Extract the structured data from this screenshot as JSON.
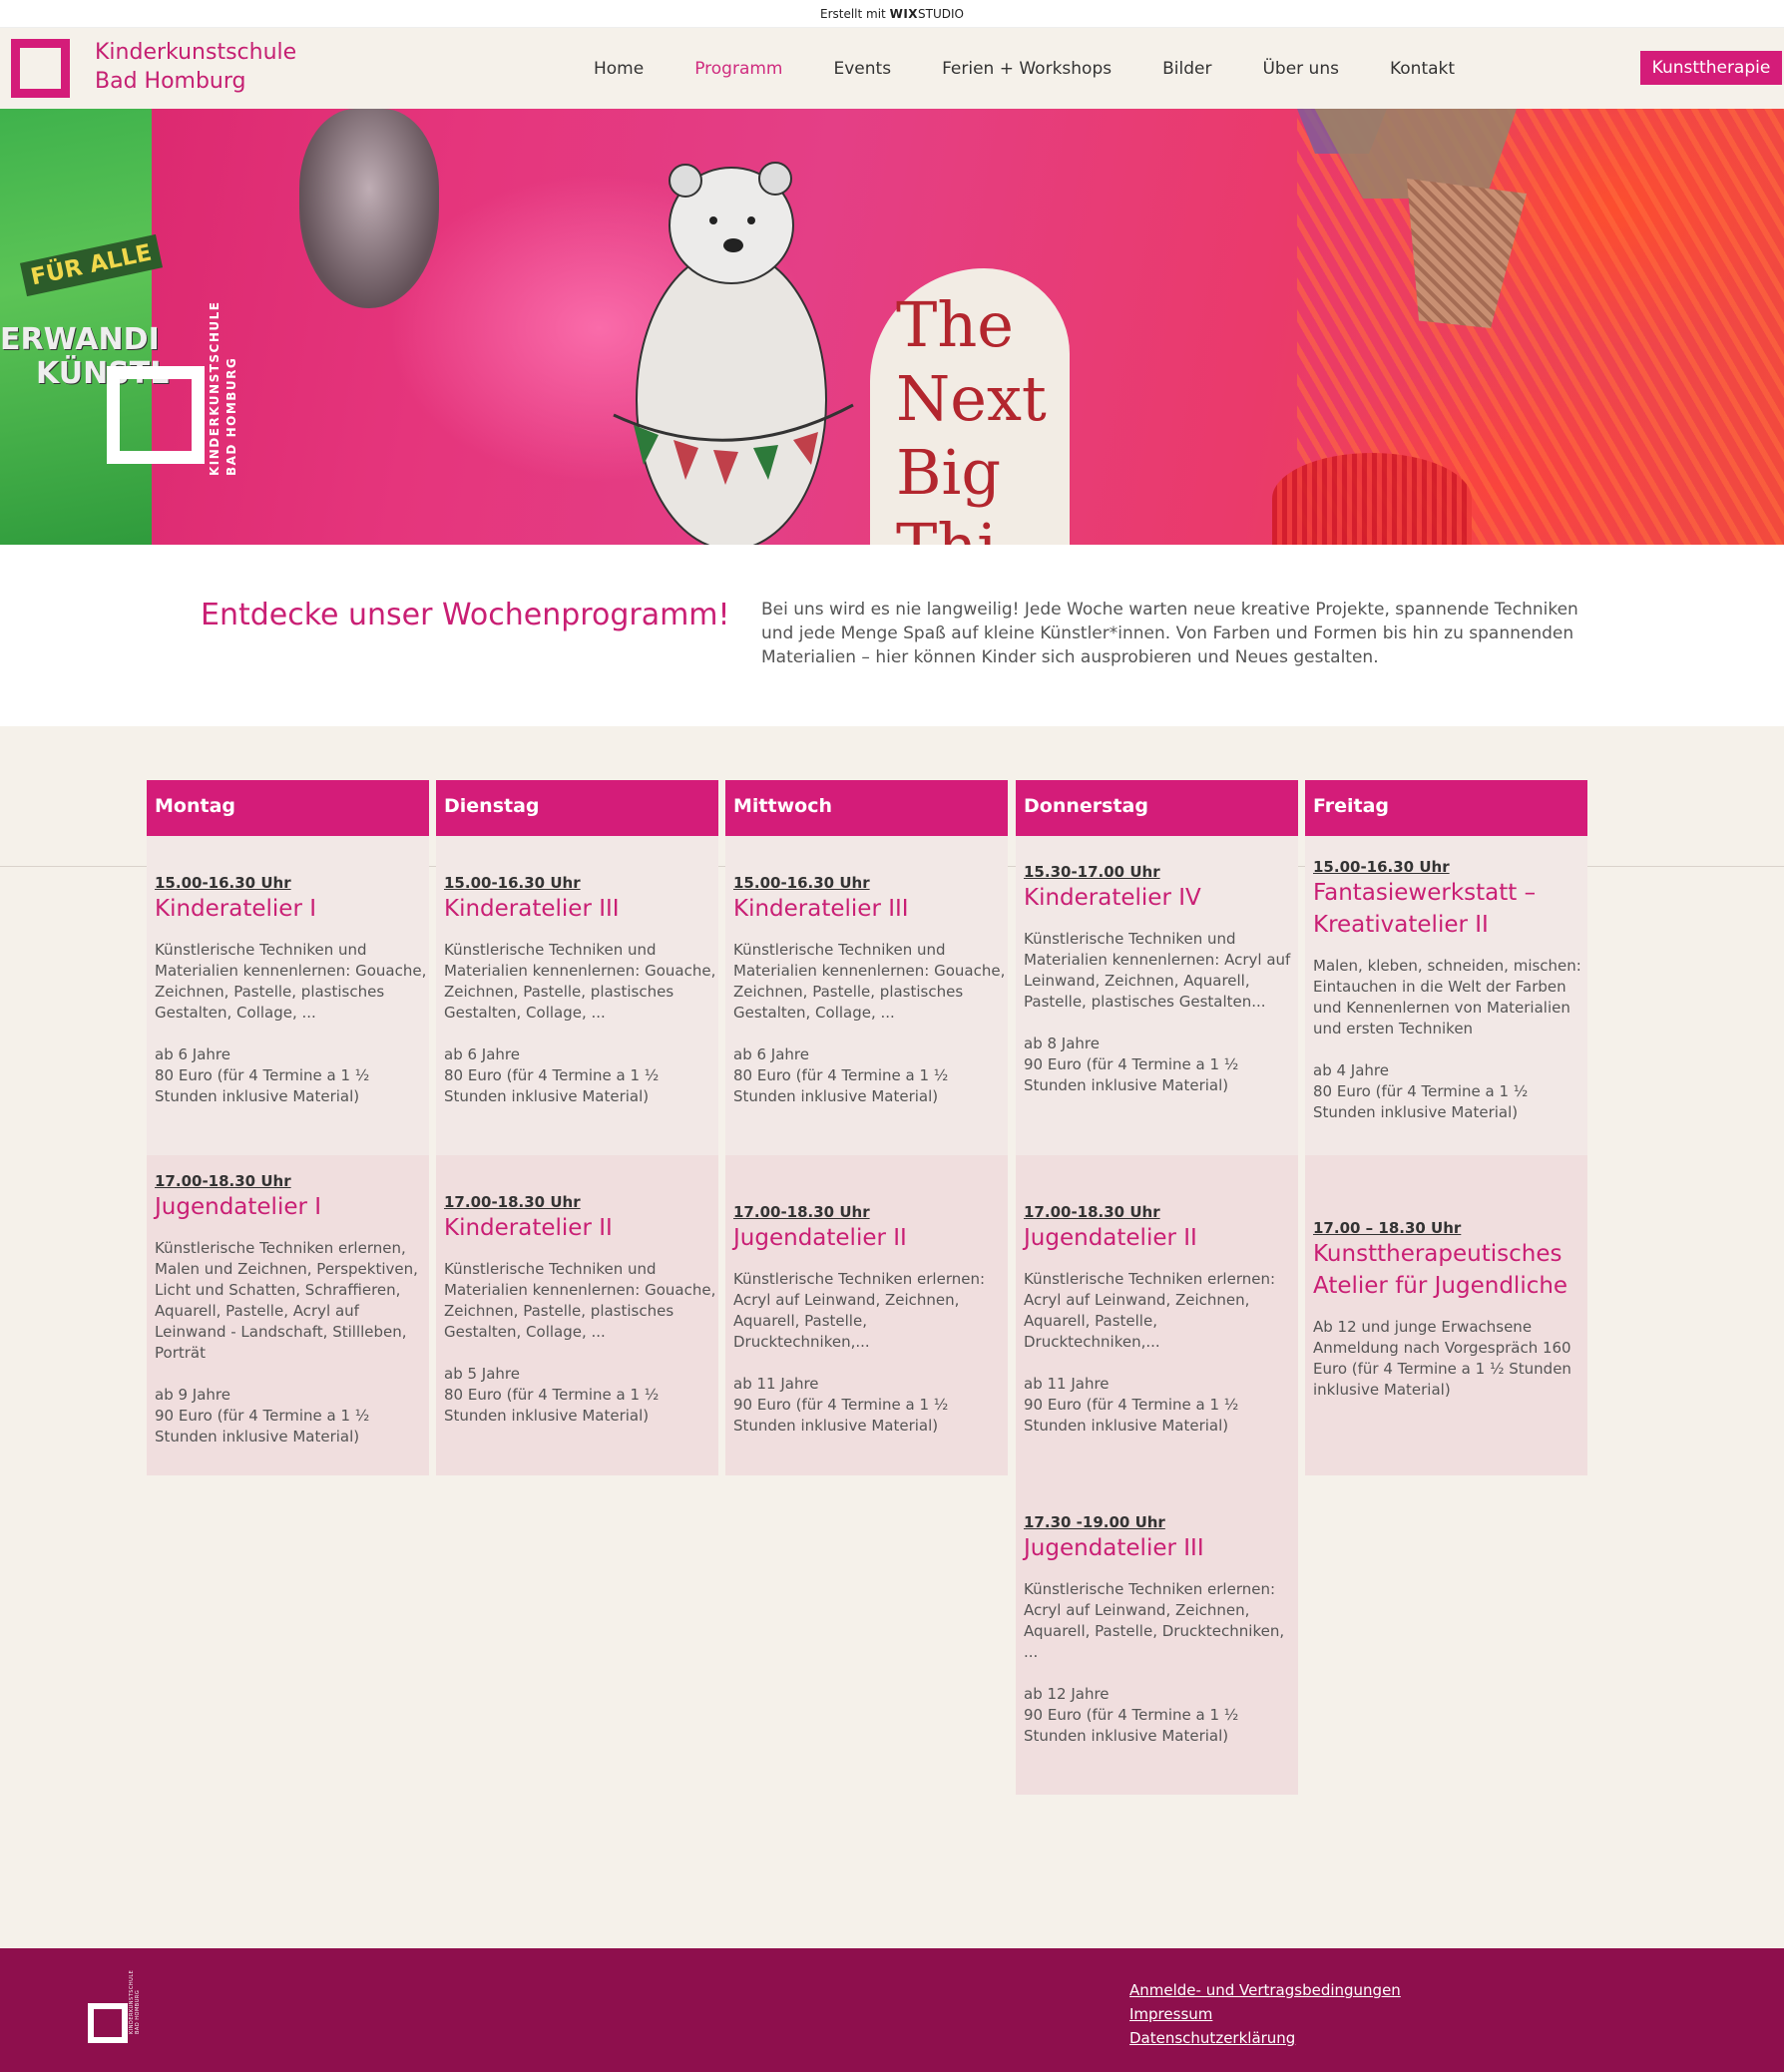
{
  "wix_banner": {
    "prefix": "Erstellt mit",
    "brand": "WIX",
    "suffix": "STUDIO"
  },
  "header": {
    "brand_line1": "Kinderkunstschule",
    "brand_line2": "Bad Homburg",
    "nav": [
      "Home",
      "Programm",
      "Events",
      "Ferien + Workshops",
      "Bilder",
      "Über uns",
      "Kontakt"
    ],
    "active_nav": "Programm",
    "cta": "Kunsttherapie",
    "accent_color": "#d41c79"
  },
  "hero": {
    "sticker": "FÜR ALLE",
    "background_word1": "ERWANDI",
    "background_word2": "KÜNSTL",
    "logo_text_line1": "KINDERKUNSTSCHULE",
    "logo_text_line2": "BAD HOMBURG",
    "headline": [
      "The",
      "Next",
      "Big",
      "Thi"
    ]
  },
  "intro": {
    "title": "Entdecke unser Wochenprogramm!",
    "text": "Bei uns wird es nie langweilig! Jede Woche warten neue kreative Projekte, spannende Techniken und jede Menge Spaß auf kleine Künstler*innen. Von Farben und Formen bis hin zu spannenden Materialien – hier können Kinder sich ausprobieren und Neues gestalten."
  },
  "schedule": [
    {
      "day": "Montag",
      "slots": [
        {
          "time": "15.00-16.30 Uhr",
          "title": "Kinderatelier I",
          "desc": "Künstlerische Techniken und Materialien kennenlernen: Gouache, Zeichnen, Pastelle, plastisches Gestalten, Collage, ...",
          "age": "ab 6 Jahre",
          "price": "80 Euro (für 4 Termine a 1 ½ Stunden inklusive Material)"
        },
        {
          "time": "17.00-18.30 Uhr",
          "title": "Jugendatelier I",
          "desc": "Künstlerische Techniken erlernen, Malen und Zeichnen, Perspektiven, Licht und Schatten, Schraffieren, Aquarell, Pastelle, Acryl auf Leinwand - Landschaft, Stillleben, Porträt",
          "age": "ab 9 Jahre",
          "price": "90 Euro (für 4 Termine a 1 ½ Stunden inklusive Material)"
        }
      ]
    },
    {
      "day": "Dienstag",
      "slots": [
        {
          "time": "15.00-16.30 Uhr",
          "title": "Kinderatelier III",
          "desc": "Künstlerische Techniken und Materialien kennenlernen: Gouache, Zeichnen, Pastelle, plastisches Gestalten, Collage, ...",
          "age": "ab 6 Jahre",
          "price": "80 Euro (für 4 Termine a  1 ½ Stunden inklusive Material)"
        },
        {
          "time": "17.00-18.30 Uhr",
          "title": "Kinderatelier II",
          "desc": "Künstlerische Techniken und Materialien kennenlernen: Gouache, Zeichnen, Pastelle, plastisches Gestalten, Collage, ...",
          "age": "ab 5 Jahre",
          "price": "80 Euro (für 4 Termine a 1 ½ Stunden inklusive Material)"
        }
      ]
    },
    {
      "day": "Mittwoch",
      "slots": [
        {
          "time": "15.00-16.30 Uhr",
          "title": "Kinderatelier III",
          "desc": "Künstlerische Techniken und Materialien kennenlernen: Gouache, Zeichnen, Pastelle, plastisches Gestalten, Collage, ...",
          "age": "ab 6 Jahre",
          "price": "80 Euro (für 4 Termine a  1 ½ Stunden inklusive Material)"
        },
        {
          "time": "17.00-18.30 Uhr",
          "title": "Jugendatelier II",
          "desc": "Künstlerische Techniken erlernen: Acryl auf Leinwand, Zeichnen, Aquarell, Pastelle, Drucktechniken,...",
          "age": "ab 11 Jahre",
          "price": "90 Euro (für 4 Termine a 1 ½ Stunden inklusive Material)"
        }
      ]
    },
    {
      "day": "Donnerstag",
      "slots": [
        {
          "time": "15.30-17.00 Uhr",
          "title": "Kinderatelier IV",
          "desc": "Künstlerische Techniken und Materialien kennenlernen: Acryl auf Leinwand, Zeichnen, Aquarell, Pastelle, plastisches Gestalten...",
          "age": "ab 8 Jahre",
          "price": "90 Euro (für 4 Termine a 1 ½ Stunden inklusive Material)"
        },
        {
          "time": "17.00-18.30 Uhr",
          "title": "Jugendatelier II",
          "desc": "Künstlerische Techniken erlernen: Acryl auf Leinwand, Zeichnen, Aquarell, Pastelle, Drucktechniken,...",
          "age": "ab 11 Jahre",
          "price": "90 Euro (für 4 Termine a 1 ½ Stunden inklusive Material)"
        },
        {
          "time": "17.30 -19.00 Uhr",
          "title": "Jugendatelier III",
          "desc": "Künstlerische Techniken erlernen: Acryl auf Leinwand, Zeichnen, Aquarell, Pastelle, Drucktechniken, ...",
          "age": "ab 12 Jahre",
          "price": "90 Euro (für 4 Termine a 1 ½ Stunden inklusive Material)"
        }
      ]
    },
    {
      "day": "Freitag",
      "slots": [
        {
          "time": "15.00-16.30 Uhr",
          "title": "Fantasiewerkstatt – Kreativatelier II",
          "desc": "Malen, kleben, schneiden, mischen: Eintauchen in die Welt der Farben und Kennenlernen von  Materialien und ersten Techniken",
          "age": "ab 4 Jahre",
          "price": "80 Euro (für 4 Termine a 1 ½ Stunden inklusive Material)"
        },
        {
          "time": "17.00 – 18.30 Uhr",
          "title": "Kunsttherapeutisches Atelier für Jugendliche",
          "desc": "",
          "age": "Ab 12 und junge Erwachsene",
          "price": "Anmeldung nach Vorgespräch 160 Euro (für 4 Termine a 1 ½ Stunden inklusive Material)"
        }
      ]
    }
  ],
  "footer": {
    "logo_text": "KINDERKUNSTSCHULE BAD HOMBURG",
    "links": [
      "Anmelde- und Vertragsbedingungen",
      "Impressum",
      "Datenschutzerklärung"
    ]
  }
}
